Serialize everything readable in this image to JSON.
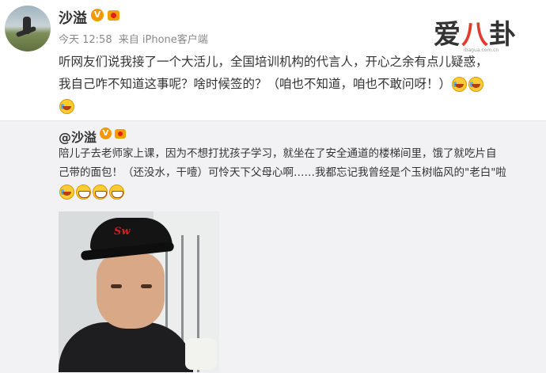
{
  "post": {
    "author": "沙溢",
    "time": "今天 12:58",
    "source": "来自 iPhone客户端",
    "lines": [
      "听网友们说我接了一个大活儿，全国培训机构的代言人，开心之余有点儿疑惑，",
      "我自己咋不知道这事呢？啥时候签的？（咱也不知道，咱也不敢问呀！）"
    ]
  },
  "watermark": {
    "brand_left": "爱",
    "brand_mid": "八",
    "brand_right": "卦",
    "site": "ibagua.com.cn"
  },
  "repost": {
    "author": "@沙溢",
    "lines": [
      "陪儿子去老师家上课，因为不想打扰孩子学习，就坐在了安全通道的楼梯间里，饿了就吃片自",
      "己带的面包！（还没水，干噎）可怜天下父母心啊……我都忘记我曾经是个玉树临风的\"老白\"啦"
    ],
    "photo_cap_text": "Sw"
  },
  "icons": {
    "verified": "verified-v-icon",
    "level": "vip-crown-icon",
    "emoji_cry": "laugh-cry-emoji",
    "emoji_grin": "grin-emoji"
  },
  "colors": {
    "verified_orange": "#f39800",
    "brand_red": "#e23b2e",
    "repost_bg": "#f2f2f5"
  },
  "badges": {
    "verified_letter": "V"
  }
}
